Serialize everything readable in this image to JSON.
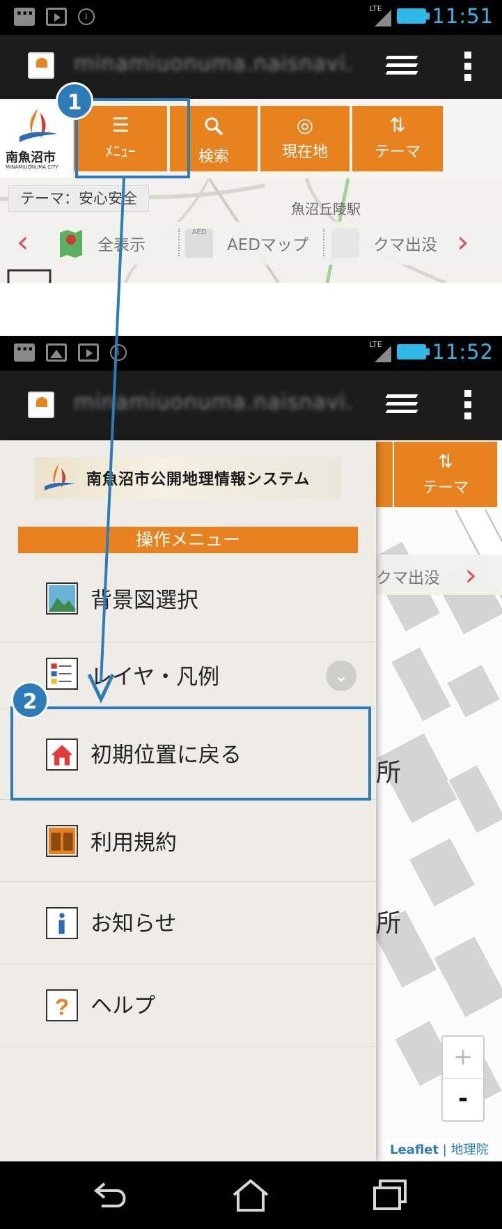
{
  "top_screen": {
    "status": {
      "time": "11:51",
      "network": "LTE"
    },
    "browser": {
      "url": "minamiuonuma.naisnavi."
    },
    "logo": {
      "name": "南魚沼市",
      "sub": "MINAMIUONUMA CITY"
    },
    "toolbar": [
      {
        "icon": "list-icon",
        "glyph": "☰",
        "label": "ﾒﾆｭｰ"
      },
      {
        "icon": "search-icon",
        "glyph": "🔍",
        "label": "検索"
      },
      {
        "icon": "location-icon",
        "glyph": "◎",
        "label": "現在地"
      },
      {
        "icon": "swap-icon",
        "glyph": "⇅",
        "label": "テーマ"
      }
    ],
    "theme_label": "テーマ：安心安全",
    "map_station": "魚沼丘陵駅",
    "theme_bar": {
      "items": [
        {
          "icon": "pin-icon",
          "label": "全表示"
        },
        {
          "icon": "aed-icon",
          "label": "AEDマップ"
        },
        {
          "icon": "bear-icon",
          "label": "クマ出没"
        }
      ]
    }
  },
  "bottom_screen": {
    "status": {
      "time": "11:52",
      "network": "LTE"
    },
    "browser": {
      "url": "minamiuonuma.naisnavi."
    },
    "banner_title": "南魚沼市公開地理情報システム",
    "menu_header": "操作メニュー",
    "menu_items": [
      {
        "icon": "landscape-icon",
        "label": "背景図選択"
      },
      {
        "icon": "legend-icon",
        "label": "レイヤ・凡例",
        "has_chevron": true
      },
      {
        "icon": "home-icon",
        "label": "初期位置に戻る"
      },
      {
        "icon": "book-icon",
        "label": "利用規約"
      },
      {
        "icon": "info-icon",
        "label": "お知らせ"
      },
      {
        "icon": "help-icon",
        "label": "ヘルプ"
      }
    ],
    "map": {
      "theme_button": "テーマ",
      "theme_item": "クマ出没",
      "place_chars": [
        "所",
        "所"
      ],
      "zoom_in": "+",
      "zoom_out": "-",
      "attribution_leaflet": "Leaflet",
      "attribution_sep": " | ",
      "attribution_gsi": "地理院"
    }
  },
  "annotations": {
    "step1": "1",
    "step2": "2"
  },
  "colors": {
    "accent": "#e8821e",
    "callout": "#2b7cb8",
    "status_blue": "#2fb7e6"
  }
}
